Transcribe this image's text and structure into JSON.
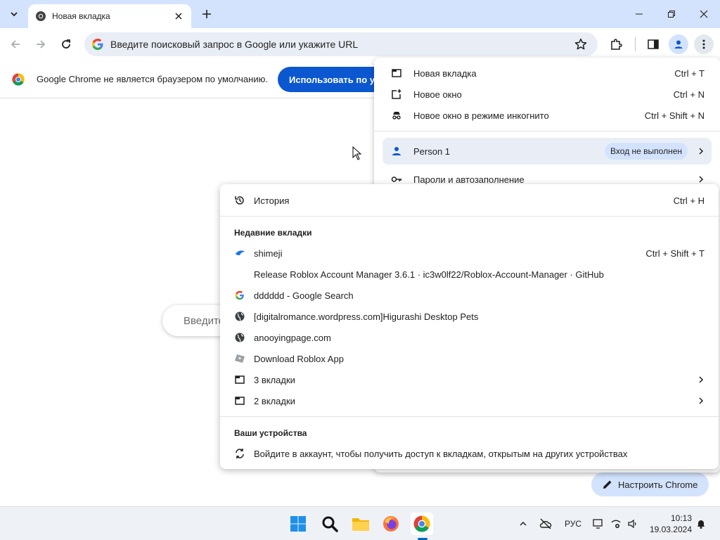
{
  "tab": {
    "title": "Новая вкладка"
  },
  "omnibox": {
    "placeholder": "Введите поисковый запрос в Google или укажите URL"
  },
  "infobar": {
    "message": "Google Chrome не является браузером по умолчанию.",
    "button_label": "Использовать по умолчанию"
  },
  "ntp": {
    "search_placeholder": "Введите поисковый запрос",
    "customize_label": "Настроить Chrome"
  },
  "main_menu": {
    "items": [
      {
        "label": "Новая вкладка",
        "shortcut": "Ctrl + T"
      },
      {
        "label": "Новое окно",
        "shortcut": "Ctrl + N"
      },
      {
        "label": "Новое окно в режиме инкогнито",
        "shortcut": "Ctrl + Shift + N"
      }
    ],
    "person": {
      "name": "Person 1",
      "status": "Вход не выполнен"
    },
    "passwords_label": "Пароли и автозаполнение"
  },
  "history_menu": {
    "history": {
      "label": "История",
      "shortcut": "Ctrl + H"
    },
    "recent_heading": "Недавние вкладки",
    "recent": [
      {
        "label": "shimeji",
        "shortcut": "Ctrl + Shift + T",
        "icon": "shimeji-favicon"
      },
      {
        "label": "Release Roblox Account Manager 3.6.1 · ic3w0lf22/Roblox-Account-Manager · GitHub",
        "shortcut": "",
        "icon": "none"
      },
      {
        "label": "dddddd - Google Search",
        "shortcut": "",
        "icon": "google-favicon"
      },
      {
        "label": "[digitalromance.wordpress.com]Higurashi Desktop Pets",
        "shortcut": "",
        "icon": "globe-icon"
      },
      {
        "label": "anooyingpage.com",
        "shortcut": "",
        "icon": "globe-icon"
      },
      {
        "label": "Download Roblox App",
        "shortcut": "",
        "icon": "roblox-favicon"
      },
      {
        "label": "3 вкладки",
        "shortcut": "",
        "icon": "window-icon"
      },
      {
        "label": "2 вкладки",
        "shortcut": "",
        "icon": "window-icon"
      }
    ],
    "devices_heading": "Ваши устройства",
    "devices_message": "Войдите в аккаунт, чтобы получить доступ к вкладкам, открытым на других устройствах"
  },
  "taskbar": {
    "language": "РУС",
    "time": "10:13",
    "date": "19.03.2024"
  },
  "colors": {
    "accent": "#0b57d0",
    "tabstrip": "#d3e3fd",
    "omnibox": "#e9eef6"
  }
}
